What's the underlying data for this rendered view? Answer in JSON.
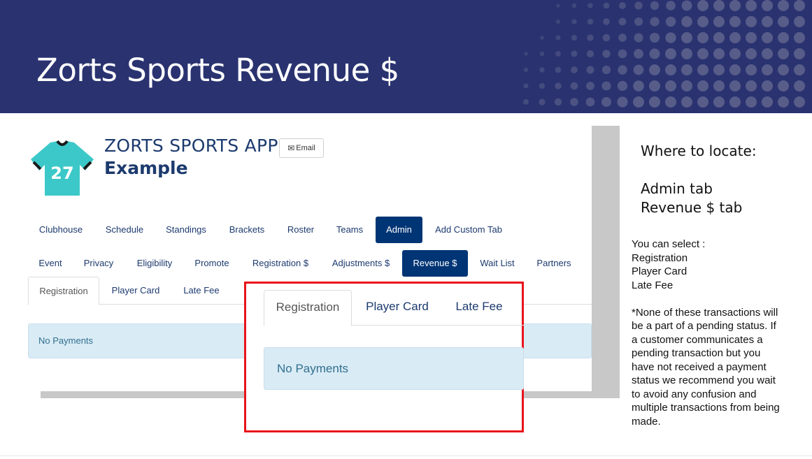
{
  "banner": {
    "title": "Zorts Sports Revenue $"
  },
  "app": {
    "title": "ZORTS SPORTS APP",
    "subtitle": "Example",
    "email_label": "Email",
    "logo_number": "27",
    "logo_color": "#3cc8c8"
  },
  "main_nav": [
    "Clubhouse",
    "Schedule",
    "Standings",
    "Brackets",
    "Roster",
    "Teams",
    "Admin",
    "Add Custom Tab"
  ],
  "admin_nav": [
    "Event",
    "Privacy",
    "Eligibility",
    "Promote",
    "Registration $",
    "Adjustments $",
    "Revenue $",
    "Wait List",
    "Partners"
  ],
  "revenue_tabs": [
    "Registration",
    "Player Card",
    "Late Fee"
  ],
  "no_payments": "No Payments",
  "sidebar": {
    "heading": "Where to locate:",
    "loc1": "Admin tab",
    "loc2": "Revenue $ tab",
    "select_intro": "You can select :",
    "options": [
      "Registration",
      "Player Card",
      "Late Fee"
    ],
    "note": "*None of these transactions will be a part of a pending status. If a customer communicates a pending transaction but you have not received a payment status we recommend you wait to avoid any confusion and multiple transactions from being made."
  },
  "colors": {
    "banner": "#2a3370",
    "active_tab": "#003575",
    "highlight": "#e8141c",
    "alert_bg": "#d9ebf5"
  }
}
